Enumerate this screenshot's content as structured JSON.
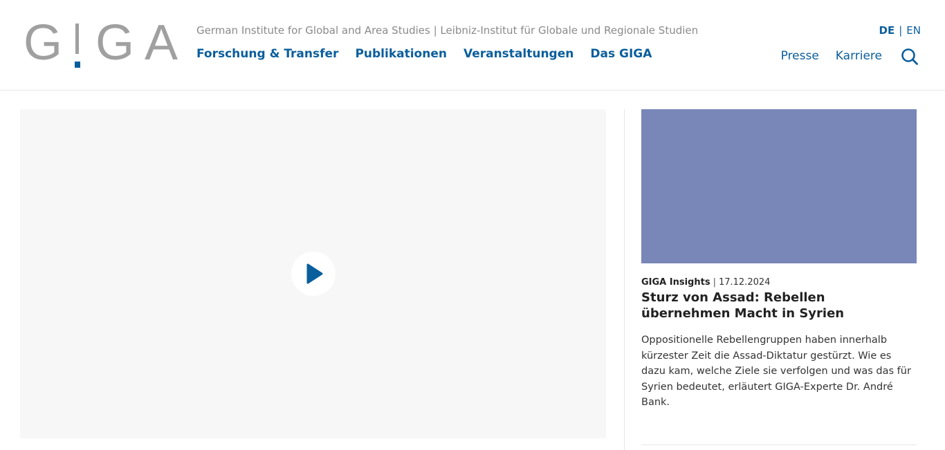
{
  "logo": {
    "alt": "GIGA",
    "letters": [
      "G",
      "I",
      "G",
      "A"
    ],
    "brand_gray": "#a0a0a0",
    "brand_blue": "#0a5e9c"
  },
  "header": {
    "tagline": "German Institute for Global and Area Studies | Leibniz-Institut für Globale und Regionale Studien",
    "main_nav": [
      "Forschung & Transfer",
      "Publikationen",
      "Veranstaltungen",
      "Das GIGA"
    ],
    "language": {
      "active": "DE",
      "separator": "|",
      "other": "EN"
    },
    "meta_nav": [
      "Presse",
      "Karriere"
    ],
    "search_icon": "search-icon"
  },
  "hero": {
    "video_background": "#f7f7f7",
    "play_icon": "play-icon"
  },
  "teaser": {
    "image_color": "#7887b8",
    "category": "GIGA Insights",
    "separator": "|",
    "date": "17.12.2024",
    "title": "Sturz von Assad: Rebellen übernehmen Macht in Syrien",
    "text": "Oppositionelle Rebellengruppen haben innerhalb kürzester Zeit die Assad-Diktatur gestürzt. Wie es dazu kam, welche Ziele sie verfolgen und was das für Syrien bedeutet, erläutert GIGA-Experte Dr. André Bank."
  },
  "colors": {
    "accent": "#0a5e9c",
    "muted_text": "#8a8a8a",
    "divider": "#e6e6e6"
  }
}
